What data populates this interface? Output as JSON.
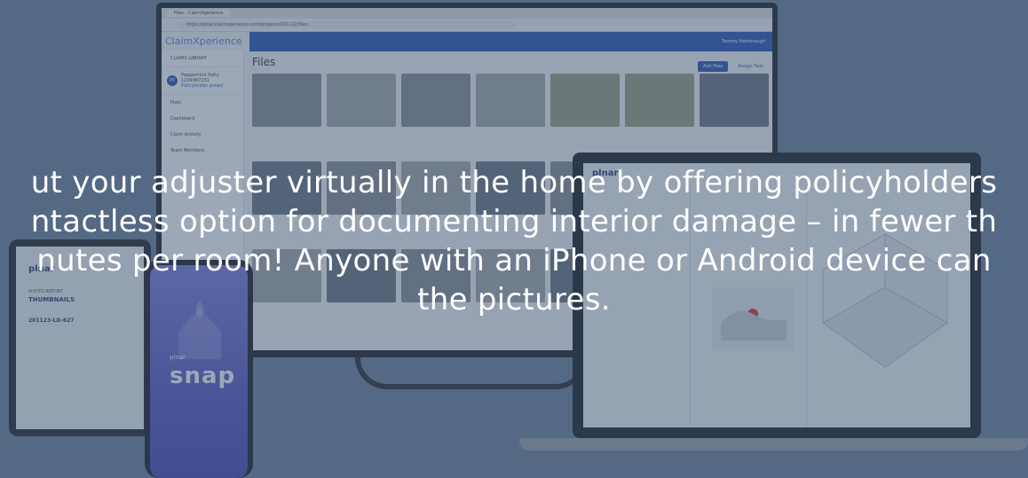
{
  "browser": {
    "tab_title": "Files - ClaimXperience",
    "url": "https://plnar.claimxperience.com/projects/201122/files"
  },
  "app": {
    "brand": "ClaimXperience",
    "user_name": "Tommy Hembrough",
    "section_title": "CLAIMS LIBRARY",
    "policyholder_name": "Peppermint Patty",
    "policyholder_id": "1234987231",
    "policyholder_initials": "PP",
    "policyholder_link": "Policyholder joined",
    "nav_heading": "Main",
    "nav_items": [
      "Dashboard",
      "Claim Activity",
      "Team Members"
    ],
    "page_title": "Files",
    "add_files_label": "Add Files",
    "assign_task_label": "Assign Task"
  },
  "tablet": {
    "logo": "plnar",
    "report_label": "PHOTO REPORT",
    "report_title": "THUMBNAILS",
    "project_id": "201123-LD-627"
  },
  "phone": {
    "brand": "plnar",
    "app_name": "snap"
  },
  "laptop": {
    "logo": "plnar"
  },
  "headline": {
    "text": "ut your adjuster virtually in the home by offering policyholders ntactless option for documenting interior damage – in fewer th nutes per room! Anyone with an iPhone or Android device can the pictures.",
    "line1": "ut your adjuster virtually in the home by offering policyholders",
    "line2": "ntactless option for documenting interior damage – in fewer th",
    "line3": "nutes per room! Anyone with an iPhone or Android device can",
    "line4": "the pictures."
  },
  "colors": {
    "overlay": "#3a5270",
    "brand_blue": "#2d57b5",
    "snap_purple": "#5959bf"
  }
}
